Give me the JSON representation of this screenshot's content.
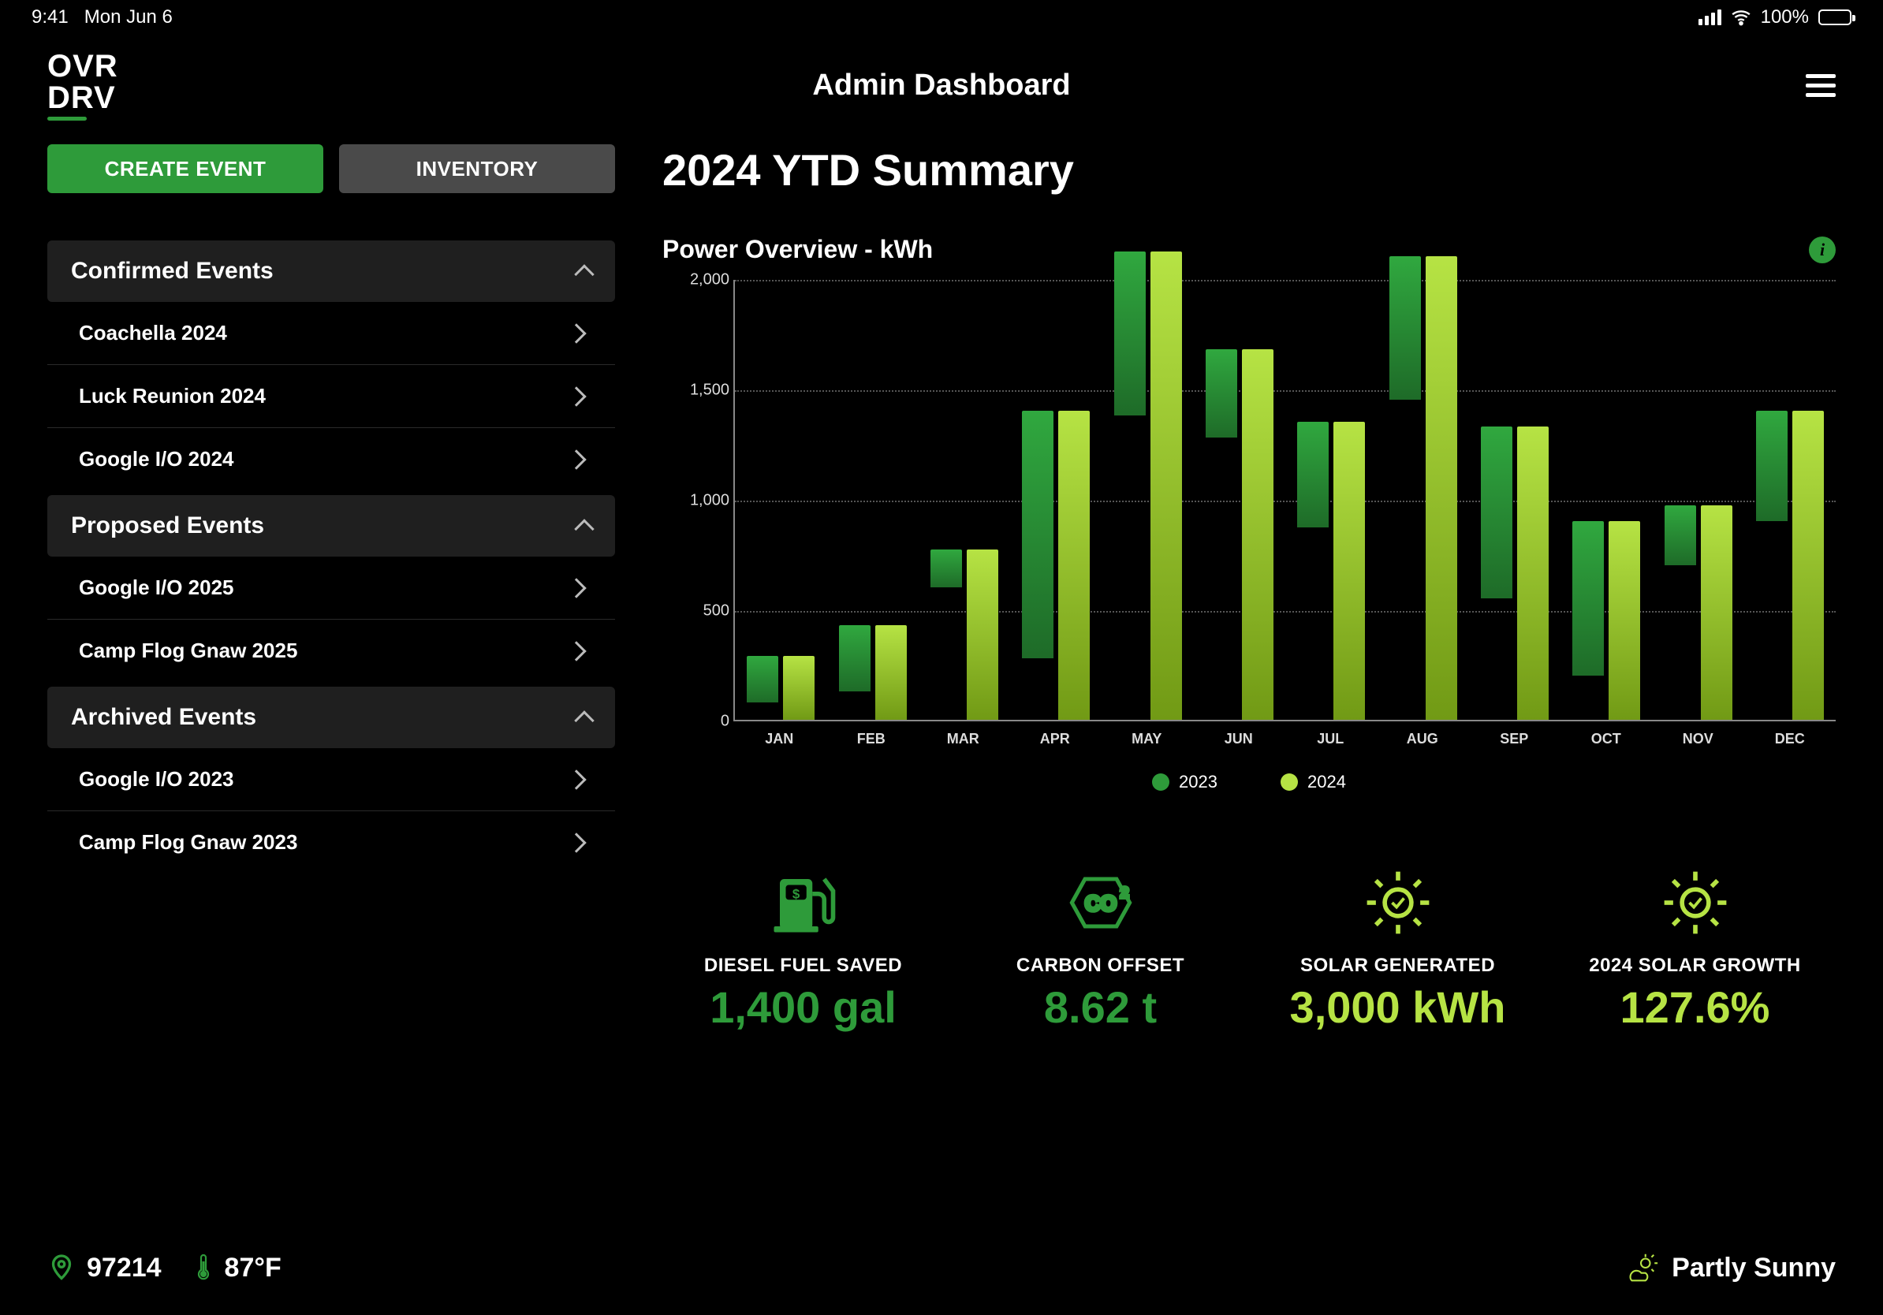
{
  "statusbar": {
    "time": "9:41",
    "date": "Mon Jun 6",
    "battery": "100%"
  },
  "header": {
    "logo_line1": "OVR",
    "logo_line2": "DRV",
    "title": "Admin Dashboard"
  },
  "sidebar": {
    "create_label": "CREATE EVENT",
    "inventory_label": "INVENTORY",
    "sections": [
      {
        "title": "Confirmed Events",
        "items": [
          "Coachella 2024",
          "Luck Reunion 2024",
          "Google I/O 2024"
        ]
      },
      {
        "title": "Proposed Events",
        "items": [
          "Google I/O 2025",
          "Camp Flog Gnaw 2025"
        ]
      },
      {
        "title": "Archived Events",
        "items": [
          "Google I/O 2023",
          "Camp Flog Gnaw 2023"
        ]
      }
    ]
  },
  "main": {
    "heading": "2024 YTD Summary",
    "chart_title": "Power Overview - kWh"
  },
  "chart_data": {
    "type": "bar",
    "categories": [
      "JAN",
      "FEB",
      "MAR",
      "APR",
      "MAY",
      "JUN",
      "JUL",
      "AUG",
      "SEP",
      "OCT",
      "NOV",
      "DEC"
    ],
    "series": [
      {
        "name": "2023",
        "values": [
          210,
          300,
          170,
          1120,
          740,
          400,
          480,
          650,
          780,
          700,
          270,
          500
        ]
      },
      {
        "name": "2024",
        "values": [
          290,
          430,
          770,
          1400,
          2120,
          1680,
          1350,
          2100,
          1330,
          900,
          970,
          1400
        ]
      }
    ],
    "ylim": [
      0,
      2000
    ],
    "yticks": [
      0,
      500,
      1000,
      1500,
      2000
    ],
    "ylabel": "",
    "xlabel": "",
    "legend": [
      "2023",
      "2024"
    ]
  },
  "stats": [
    {
      "label": "DIESEL FUEL SAVED",
      "value": "1,400 gal",
      "color": "green",
      "icon": "fuel"
    },
    {
      "label": "CARBON OFFSET",
      "value": "8.62 t",
      "color": "green",
      "icon": "co2"
    },
    {
      "label": "SOLAR GENERATED",
      "value": "3,000 kWh",
      "color": "lime",
      "icon": "sun"
    },
    {
      "label": "2024 SOLAR GROWTH",
      "value": "127.6%",
      "color": "lime",
      "icon": "sun"
    }
  ],
  "footer": {
    "zip": "97214",
    "temp": "87°F",
    "weather": "Partly Sunny"
  },
  "colors": {
    "green": "#2e9b3a",
    "lime": "#b6e344",
    "panel": "#1f1f1f"
  }
}
